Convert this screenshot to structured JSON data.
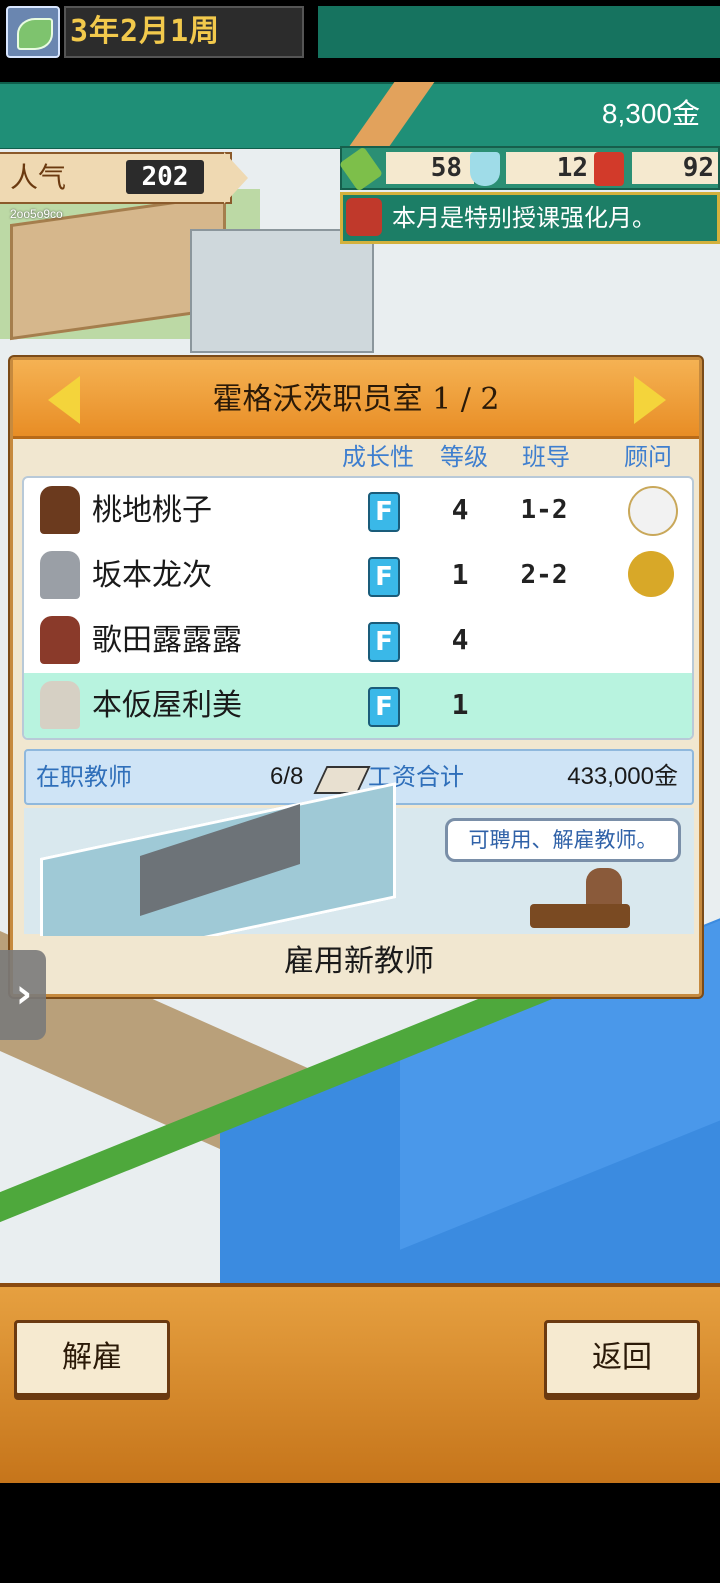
{
  "header": {
    "date": "3年2月1周",
    "money": "8,300金"
  },
  "popularity": {
    "label": "人气",
    "value": "202",
    "small_code": "2oo5o9co"
  },
  "resources": [
    {
      "icon": "pencil-icon",
      "value": "58"
    },
    {
      "icon": "flask-icon",
      "value": "12"
    },
    {
      "icon": "book-icon",
      "value": "92"
    }
  ],
  "notice": {
    "icon": "megaphone-icon",
    "text": "本月是特别授课强化月。"
  },
  "panel": {
    "title": "霍格沃茨职员室 1 / 2",
    "columns": {
      "growth": "成长性",
      "level": "等级",
      "homeroom": "班导",
      "advisor": "顾问"
    },
    "teachers": [
      {
        "name": "桃地桃子",
        "growth": "F",
        "level": "4",
        "homeroom": "1-2",
        "advisor": "baseball-bat-icon"
      },
      {
        "name": "坂本龙次",
        "growth": "F",
        "level": "1",
        "homeroom": "2-2",
        "advisor": "horn-icon"
      },
      {
        "name": "歌田露露露",
        "growth": "F",
        "level": "4",
        "homeroom": "",
        "advisor": ""
      },
      {
        "name": "本仮屋利美",
        "growth": "F",
        "level": "1",
        "homeroom": "",
        "advisor": ""
      }
    ],
    "summary": {
      "staff_label": "在职教师",
      "staff_count": "6/8",
      "salary_label": "工资合计",
      "salary_value": "433,000金"
    },
    "speech": "可聘用、解雇教师。",
    "hire_button": "雇用新教师"
  },
  "bottom": {
    "fire_button": "解雇",
    "back_button": "返回"
  },
  "colors": {
    "header_green": "#1f8f77",
    "panel_orange": "#e88d25",
    "selected_row": "#b8f3df",
    "column_head_blue": "#3f7fcf"
  }
}
